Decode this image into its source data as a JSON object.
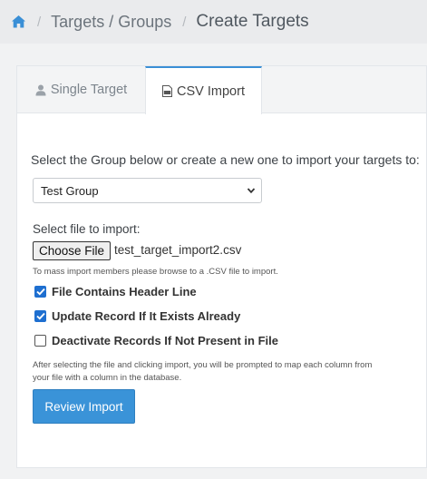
{
  "breadcrumb": {
    "home_icon": "home-icon",
    "targets_groups": "Targets / Groups",
    "current": "Create Targets",
    "separator": "/"
  },
  "tabs": [
    {
      "label": "Single Target",
      "icon": "user-icon",
      "active": false
    },
    {
      "label": "CSV Import",
      "icon": "csv-file-icon",
      "active": true
    }
  ],
  "form": {
    "intro": "Select the Group below or create a new one to import your targets to:",
    "group_select_value": "Test Group",
    "file_label": "Select file to import:",
    "choose_file_label": "Choose File",
    "file_name": "test_target_import2.csv",
    "help_text": "To mass import members please browse to a .CSV file to import.",
    "options": [
      {
        "label": "File Contains Header Line",
        "checked": true
      },
      {
        "label": "Update Record If It Exists Already",
        "checked": true
      },
      {
        "label": "Deactivate Records If Not Present in File",
        "checked": false
      }
    ],
    "note": "After selecting the file and clicking import, you will be prompted to map each column from your file with a column in the database.",
    "submit_label": "Review Import"
  },
  "colors": {
    "accent": "#3a93d8",
    "checkbox": "#1e6fd0",
    "home_icon": "#3a8fd6"
  }
}
